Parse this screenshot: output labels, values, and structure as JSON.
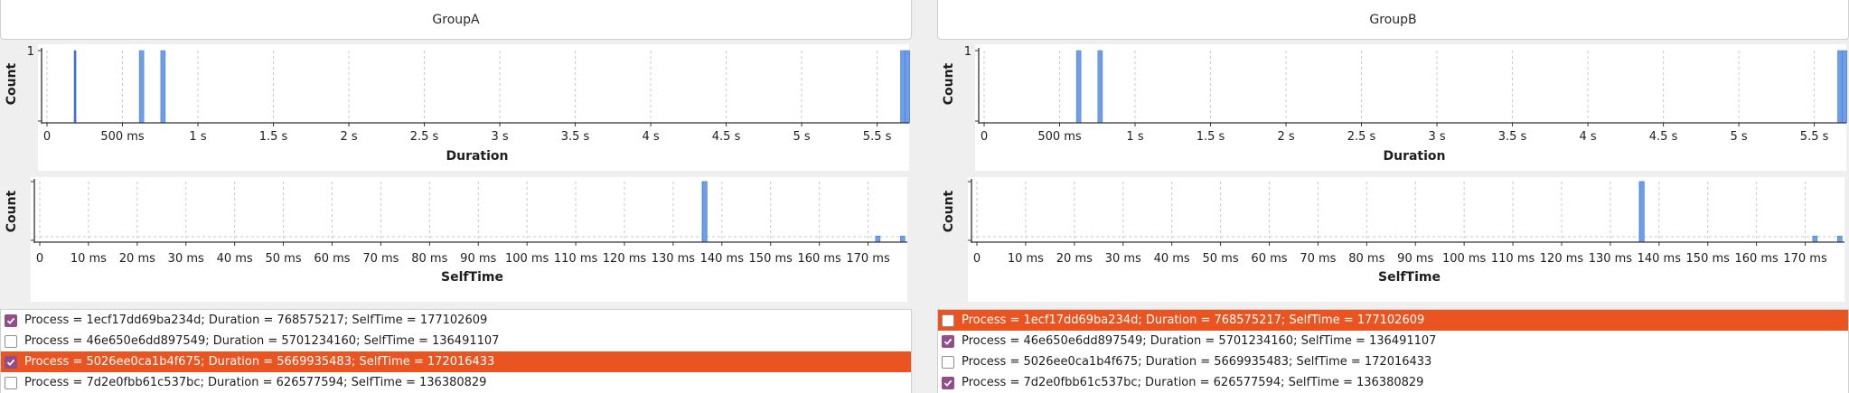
{
  "groups": [
    {
      "title": "GroupA",
      "rows": [
        {
          "label": "Process = 1ecf17dd69ba234d; Duration = 768575217; SelfTime = 177102609",
          "checked": true,
          "selected": false
        },
        {
          "label": "Process = 46e650e6dd897549; Duration = 5701234160; SelfTime = 136491107",
          "checked": false,
          "selected": false
        },
        {
          "label": "Process = 5026ee0ca1b4f675; Duration = 5669935483; SelfTime = 172016433",
          "checked": true,
          "selected": true
        },
        {
          "label": "Process = 7d2e0fbb61c537bc; Duration = 626577594; SelfTime = 136380829",
          "checked": false,
          "selected": false
        }
      ]
    },
    {
      "title": "GroupB",
      "rows": [
        {
          "label": "Process = 1ecf17dd69ba234d; Duration = 768575217; SelfTime = 177102609",
          "checked": false,
          "selected": true
        },
        {
          "label": "Process = 46e650e6dd897549; Duration = 5701234160; SelfTime = 136491107",
          "checked": true,
          "selected": false
        },
        {
          "label": "Process = 5026ee0ca1b4f675; Duration = 5669935483; SelfTime = 172016433",
          "checked": false,
          "selected": false
        },
        {
          "label": "Process = 7d2e0fbb61c537bc; Duration = 626577594; SelfTime = 136380829",
          "checked": true,
          "selected": false
        }
      ]
    }
  ],
  "colors": {
    "bar": "#6f9ee8",
    "bar_highlight": "#3b6fd0",
    "selection": "#e95420",
    "checkbox": "#924d8b"
  },
  "chart_data": [
    {
      "group": "GroupA",
      "type": "bar",
      "xlabel": "Duration",
      "ylabel": "Count",
      "xlim_ms": [
        0,
        5700
      ],
      "ylim": [
        0,
        1
      ],
      "y_ticks": [
        "1"
      ],
      "x_ticks": [
        {
          "value": 0,
          "label": "0"
        },
        {
          "value": 500,
          "label": "500 ms"
        },
        {
          "value": 1000,
          "label": "1 s"
        },
        {
          "value": 1500,
          "label": "1.5 s"
        },
        {
          "value": 2000,
          "label": "2 s"
        },
        {
          "value": 2500,
          "label": "2.5 s"
        },
        {
          "value": 3000,
          "label": "3 s"
        },
        {
          "value": 3500,
          "label": "3.5 s"
        },
        {
          "value": 4000,
          "label": "4 s"
        },
        {
          "value": 4500,
          "label": "4.5 s"
        },
        {
          "value": 5000,
          "label": "5 s"
        },
        {
          "value": 5500,
          "label": "5.5 s"
        }
      ],
      "bars": [
        {
          "x_ms": 186,
          "count": 1,
          "highlight": true
        },
        {
          "x_ms": 626.6,
          "count": 1,
          "highlight": false
        },
        {
          "x_ms": 768.6,
          "count": 1,
          "highlight": false
        },
        {
          "x_ms": 5669.9,
          "count": 1,
          "highlight": false
        },
        {
          "x_ms": 5701.2,
          "count": 1,
          "highlight": false
        }
      ]
    },
    {
      "group": "GroupA",
      "type": "bar",
      "xlabel": "SelfTime",
      "ylabel": "Count",
      "xlim_ms": [
        0,
        177.5
      ],
      "ylim": [
        0,
        1
      ],
      "x_ticks": [
        {
          "value": 0,
          "label": "0"
        },
        {
          "value": 10,
          "label": "10 ms"
        },
        {
          "value": 20,
          "label": "20 ms"
        },
        {
          "value": 30,
          "label": "30 ms"
        },
        {
          "value": 40,
          "label": "40 ms"
        },
        {
          "value": 50,
          "label": "50 ms"
        },
        {
          "value": 60,
          "label": "60 ms"
        },
        {
          "value": 70,
          "label": "70 ms"
        },
        {
          "value": 80,
          "label": "80 ms"
        },
        {
          "value": 90,
          "label": "90 ms"
        },
        {
          "value": 100,
          "label": "100 ms"
        },
        {
          "value": 110,
          "label": "110 ms"
        },
        {
          "value": 120,
          "label": "120 ms"
        },
        {
          "value": 130,
          "label": "130 ms"
        },
        {
          "value": 140,
          "label": "140 ms"
        },
        {
          "value": 150,
          "label": "150 ms"
        },
        {
          "value": 160,
          "label": "160 ms"
        },
        {
          "value": 170,
          "label": "170 ms"
        }
      ],
      "bars": [
        {
          "x_ms": 136.4,
          "count": 1,
          "highlight": false
        },
        {
          "x_ms": 136.5,
          "count": 1,
          "highlight": false
        },
        {
          "x_ms": 172.0,
          "count": 0.1,
          "highlight": false
        },
        {
          "x_ms": 177.1,
          "count": 0.1,
          "highlight": false
        }
      ]
    },
    {
      "group": "GroupB",
      "type": "bar",
      "xlabel": "Duration",
      "ylabel": "Count",
      "xlim_ms": [
        0,
        5700
      ],
      "ylim": [
        0,
        1
      ],
      "y_ticks": [
        "1"
      ],
      "x_ticks": [
        {
          "value": 0,
          "label": "0"
        },
        {
          "value": 500,
          "label": "500 ms"
        },
        {
          "value": 1000,
          "label": "1 s"
        },
        {
          "value": 1500,
          "label": "1.5 s"
        },
        {
          "value": 2000,
          "label": "2 s"
        },
        {
          "value": 2500,
          "label": "2.5 s"
        },
        {
          "value": 3000,
          "label": "3 s"
        },
        {
          "value": 3500,
          "label": "3.5 s"
        },
        {
          "value": 4000,
          "label": "4 s"
        },
        {
          "value": 4500,
          "label": "4.5 s"
        },
        {
          "value": 5000,
          "label": "5 s"
        },
        {
          "value": 5500,
          "label": "5.5 s"
        }
      ],
      "bars": [
        {
          "x_ms": 626.6,
          "count": 1,
          "highlight": false
        },
        {
          "x_ms": 768.6,
          "count": 1,
          "highlight": false
        },
        {
          "x_ms": 5669.9,
          "count": 1,
          "highlight": false
        },
        {
          "x_ms": 5701.2,
          "count": 1,
          "highlight": false
        }
      ]
    },
    {
      "group": "GroupB",
      "type": "bar",
      "xlabel": "SelfTime",
      "ylabel": "Count",
      "xlim_ms": [
        0,
        177.5
      ],
      "ylim": [
        0,
        1
      ],
      "x_ticks": [
        {
          "value": 0,
          "label": "0"
        },
        {
          "value": 10,
          "label": "10 ms"
        },
        {
          "value": 20,
          "label": "20 ms"
        },
        {
          "value": 30,
          "label": "30 ms"
        },
        {
          "value": 40,
          "label": "40 ms"
        },
        {
          "value": 50,
          "label": "50 ms"
        },
        {
          "value": 60,
          "label": "60 ms"
        },
        {
          "value": 70,
          "label": "70 ms"
        },
        {
          "value": 80,
          "label": "80 ms"
        },
        {
          "value": 90,
          "label": "90 ms"
        },
        {
          "value": 100,
          "label": "100 ms"
        },
        {
          "value": 110,
          "label": "110 ms"
        },
        {
          "value": 120,
          "label": "120 ms"
        },
        {
          "value": 130,
          "label": "130 ms"
        },
        {
          "value": 140,
          "label": "140 ms"
        },
        {
          "value": 150,
          "label": "150 ms"
        },
        {
          "value": 160,
          "label": "160 ms"
        },
        {
          "value": 170,
          "label": "170 ms"
        }
      ],
      "bars": [
        {
          "x_ms": 136.4,
          "count": 1,
          "highlight": false
        },
        {
          "x_ms": 136.5,
          "count": 1,
          "highlight": false
        },
        {
          "x_ms": 172.0,
          "count": 0.1,
          "highlight": false
        },
        {
          "x_ms": 177.1,
          "count": 0.1,
          "highlight": false
        }
      ]
    }
  ]
}
